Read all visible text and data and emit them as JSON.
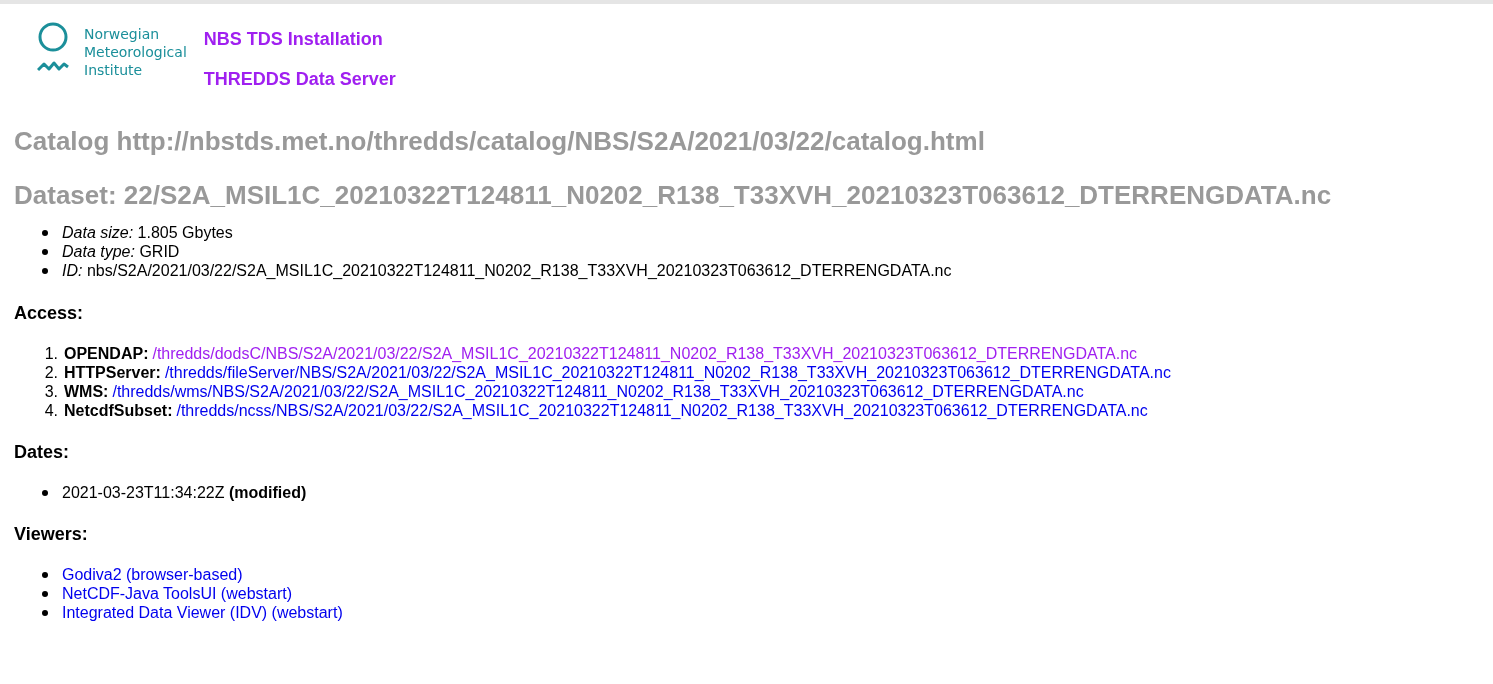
{
  "header": {
    "logo_lines": [
      "Norwegian",
      "Meteorological",
      "Institute"
    ],
    "links": [
      {
        "text": "NBS TDS Installation",
        "visited": true
      },
      {
        "text": "THREDDS Data Server",
        "visited": true
      }
    ]
  },
  "catalog_title": "Catalog http://nbstds.met.no/thredds/catalog/NBS/S2A/2021/03/22/catalog.html",
  "dataset_title": "Dataset: 22/S2A_MSIL1C_20210322T124811_N0202_R138_T33XVH_20210323T063612_DTERRENGDATA.nc",
  "properties": [
    {
      "label": "Data size:",
      "value": "1.805 Gbytes"
    },
    {
      "label": "Data type:",
      "value": "GRID"
    },
    {
      "label": "ID:",
      "value": "nbs/S2A/2021/03/22/S2A_MSIL1C_20210322T124811_N0202_R138_T33XVH_20210323T063612_DTERRENGDATA.nc"
    }
  ],
  "access": {
    "heading": "Access:",
    "items": [
      {
        "number": "1.",
        "service": "OPENDAP:",
        "url": "/thredds/dodsC/NBS/S2A/2021/03/22/S2A_MSIL1C_20210322T124811_N0202_R138_T33XVH_20210323T063612_DTERRENGDATA.nc",
        "visited": true
      },
      {
        "number": "2.",
        "service": "HTTPServer:",
        "url": "/thredds/fileServer/NBS/S2A/2021/03/22/S2A_MSIL1C_20210322T124811_N0202_R138_T33XVH_20210323T063612_DTERRENGDATA.nc",
        "visited": false
      },
      {
        "number": "3.",
        "service": "WMS:",
        "url": "/thredds/wms/NBS/S2A/2021/03/22/S2A_MSIL1C_20210322T124811_N0202_R138_T33XVH_20210323T063612_DTERRENGDATA.nc",
        "visited": false
      },
      {
        "number": "4.",
        "service": "NetcdfSubset:",
        "url": "/thredds/ncss/NBS/S2A/2021/03/22/S2A_MSIL1C_20210322T124811_N0202_R138_T33XVH_20210323T063612_DTERRENGDATA.nc",
        "visited": false
      }
    ]
  },
  "dates": {
    "heading": "Dates:",
    "items": [
      {
        "date": "2021-03-23T11:34:22Z",
        "type": "(modified)"
      }
    ]
  },
  "viewers": {
    "heading": "Viewers:",
    "items": [
      {
        "text": "Godiva2 (browser-based)",
        "visited": false
      },
      {
        "text": "NetCDF-Java ToolsUI (webstart)",
        "visited": false
      },
      {
        "text": "Integrated Data Viewer (IDV) (webstart)",
        "visited": false
      }
    ]
  }
}
